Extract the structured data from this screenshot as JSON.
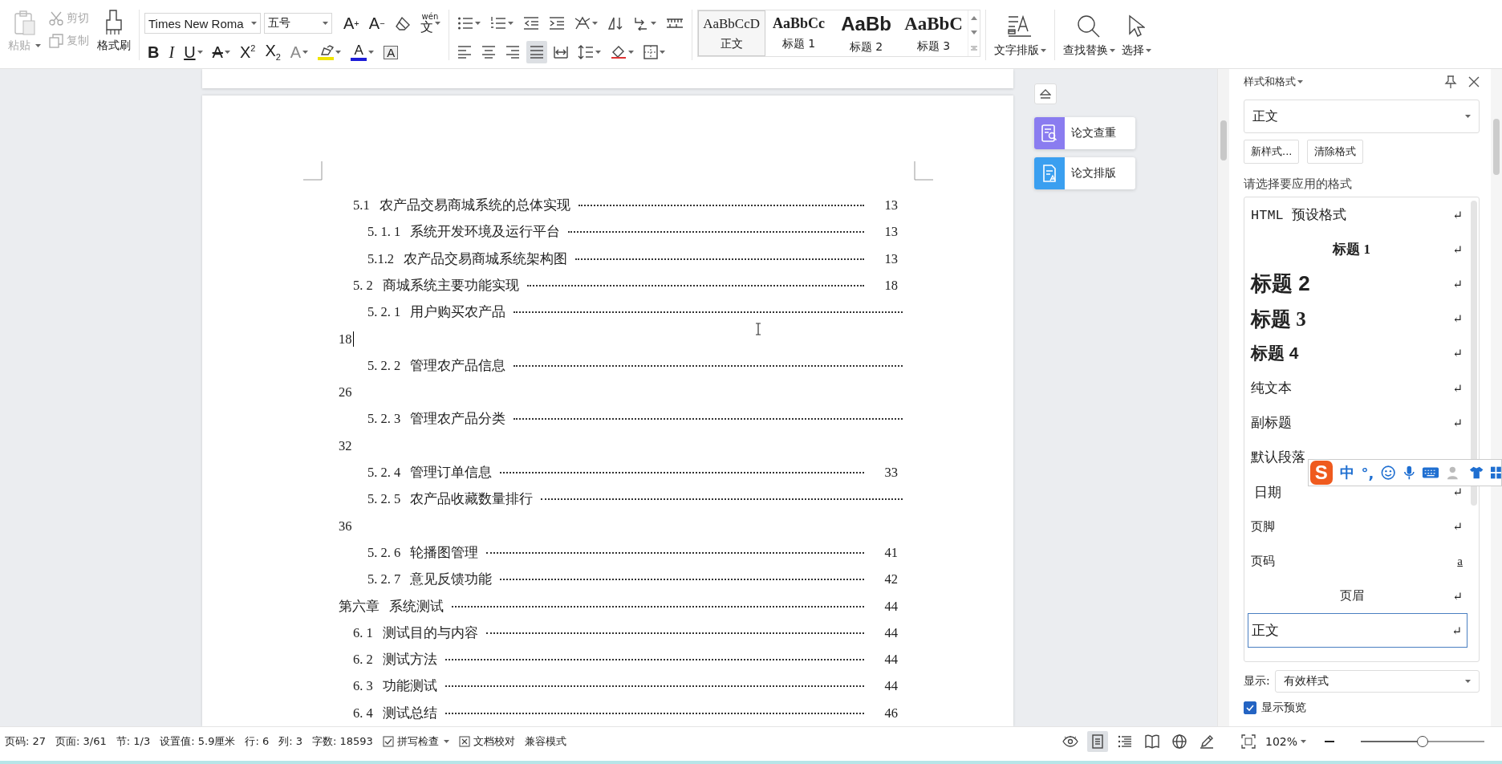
{
  "toolbar": {
    "clipboard": [
      {
        "kind": "paste",
        "label": "粘贴",
        "disabled": true,
        "caret": true
      },
      {
        "kind": "cut",
        "label": "剪切",
        "disabled": true,
        "caret": false
      },
      {
        "kind": "copy",
        "label": "复制",
        "disabled": true,
        "caret": false
      },
      {
        "kind": "painter",
        "label": "格式刷",
        "disabled": false,
        "caret": false
      }
    ],
    "font_name": "Times New Roma",
    "font_size": "五号",
    "font_tools": [
      {
        "kind": "grow",
        "glyph": "A$^{+}$"
      },
      {
        "kind": "shrink",
        "glyph": "A$^{−}$"
      },
      {
        "kind": "clear"
      },
      {
        "kind": "pinyin",
        "glyph": "wén",
        "base": "文"
      }
    ],
    "format_tools": [
      {
        "kind": "bold",
        "glyph": "B",
        "caret": false,
        "disabled": false
      },
      {
        "kind": "italic",
        "glyph": "I",
        "caret": false,
        "disabled": false
      },
      {
        "kind": "underline",
        "glyph": "U",
        "caret": true,
        "disabled": false
      },
      {
        "kind": "strike",
        "glyph": "A",
        "caret": true,
        "disabled": false
      },
      {
        "kind": "sup",
        "glyph": "X$^{2}$",
        "caret": false,
        "disabled": false
      },
      {
        "kind": "sub",
        "glyph": "X$_{2}$",
        "caret": false,
        "disabled": false
      },
      {
        "kind": "effect",
        "glyph": "A",
        "caret": true,
        "disabled": true
      },
      {
        "kind": "highlight",
        "caret": true,
        "disabled": false,
        "color": "#f0e400"
      },
      {
        "kind": "color",
        "glyph": "A",
        "caret": true,
        "disabled": false,
        "color": "#1c1cd8"
      },
      {
        "kind": "boxed",
        "glyph": "A",
        "caret": false,
        "disabled": false
      }
    ],
    "paragraph_row1": [
      {
        "kind": "bullets",
        "caret": true
      },
      {
        "kind": "numbering",
        "caret": true
      },
      {
        "kind": "outdent",
        "caret": false
      },
      {
        "kind": "indent",
        "caret": false
      },
      {
        "kind": "cnlayout",
        "caret": true
      },
      {
        "kind": "sort",
        "caret": false
      },
      {
        "kind": "direction",
        "caret": true
      },
      {
        "kind": "tabs",
        "caret": false
      }
    ],
    "alignment": [
      {
        "kind": "left",
        "selected": false
      },
      {
        "kind": "center",
        "selected": false
      },
      {
        "kind": "right",
        "selected": false
      },
      {
        "kind": "justify",
        "selected": true
      },
      {
        "kind": "distribute",
        "selected": false
      }
    ],
    "paragraph_row2": [
      {
        "kind": "linespacing",
        "caret": true
      },
      {
        "kind": "shading",
        "caret": true
      },
      {
        "kind": "borders",
        "caret": true
      }
    ],
    "styles": [
      {
        "kind": "normal",
        "preview": "AaBbCcD",
        "label": "正文",
        "selected": true
      },
      {
        "kind": "h1",
        "preview": "AaBbCc",
        "label": "标题 1",
        "selected": false
      },
      {
        "kind": "h2",
        "preview": "AaBb",
        "label": "标题 2",
        "selected": false
      },
      {
        "kind": "h3",
        "preview": "AaBbC",
        "label": "标题 3",
        "selected": false
      }
    ],
    "tools": [
      {
        "kind": "textlayout",
        "label": "文字排版"
      },
      {
        "kind": "find",
        "label": "查找替换"
      },
      {
        "kind": "select",
        "label": "选择"
      }
    ]
  },
  "side_tools": [
    {
      "kind": "check",
      "label": "论文查重"
    },
    {
      "kind": "layout",
      "label": "论文排版"
    }
  ],
  "toc": [
    {
      "kind": "section",
      "num": "5.1",
      "title": "农产品交易商城系统的总体实现",
      "page": "13",
      "wrap": false,
      "cursor": false,
      "children": [
        {
          "kind": "subsection",
          "num": "5. 1. 1",
          "title": "系统开发环境及运行平台",
          "page": "13",
          "wrap": false,
          "cursor": false
        },
        {
          "kind": "subsection",
          "num": "5.1.2",
          "title": "农产品交易商城系统架构图",
          "page": "13",
          "wrap": false,
          "cursor": false
        }
      ]
    },
    {
      "kind": "section",
      "num": "5. 2",
      "title": "商城系统主要功能实现",
      "page": "18",
      "wrap": false,
      "cursor": false,
      "children": [
        {
          "kind": "subsection",
          "num": "5. 2. 1",
          "title": "用户购买农产品",
          "page": "18",
          "wrap": true,
          "cursor": true
        },
        {
          "kind": "subsection",
          "num": "5. 2. 2",
          "title": "管理农产品信息",
          "page": "26",
          "wrap": true,
          "cursor": false
        },
        {
          "kind": "subsection",
          "num": "5. 2. 3",
          "title": "管理农产品分类",
          "page": "32",
          "wrap": true,
          "cursor": false
        },
        {
          "kind": "subsection",
          "num": "5. 2. 4",
          "title": "管理订单信息",
          "page": "33",
          "wrap": false,
          "cursor": false
        },
        {
          "kind": "subsection",
          "num": "5. 2. 5",
          "title": "农产品收藏数量排行",
          "page": "36",
          "wrap": true,
          "cursor": false
        },
        {
          "kind": "subsection",
          "num": "5. 2. 6",
          "title": "轮播图管理",
          "page": "41",
          "wrap": false,
          "cursor": false
        },
        {
          "kind": "subsection",
          "num": "5. 2. 7",
          "title": "意见反馈功能",
          "page": "42",
          "wrap": false,
          "cursor": false
        }
      ]
    },
    {
      "kind": "chapter",
      "num": "第六章",
      "title": "系统测试",
      "page": "44",
      "wrap": false,
      "cursor": false,
      "children": [
        {
          "kind": "section",
          "num": "6. 1",
          "title": "测试目的与内容",
          "page": "44",
          "wrap": false,
          "cursor": false
        },
        {
          "kind": "section",
          "num": "6. 2",
          "title": "测试方法",
          "page": "44",
          "wrap": false,
          "cursor": false
        },
        {
          "kind": "section",
          "num": "6. 3",
          "title": "功能测试",
          "page": "44",
          "wrap": false,
          "cursor": false
        },
        {
          "kind": "section",
          "num": "6. 4",
          "title": "测试总结",
          "page": "46",
          "wrap": false,
          "cursor": false
        }
      ]
    }
  ],
  "panel": {
    "title": "样式和格式",
    "current_style": "正文",
    "buttons": [
      "新样式...",
      "清除格式"
    ],
    "prompt": "请选择要应用的格式",
    "styles": [
      {
        "kind": "html",
        "text": "HTML 预设格式",
        "mark": "↵",
        "selected": false
      },
      {
        "kind": "h1",
        "text": "标题 1",
        "mark": "↵",
        "selected": false
      },
      {
        "kind": "h2",
        "text": "标题 2",
        "mark": "↵",
        "selected": false
      },
      {
        "kind": "h3",
        "text": "标题 3",
        "mark": "↵",
        "selected": false
      },
      {
        "kind": "h4",
        "text": "标题 4",
        "mark": "↵",
        "selected": false
      },
      {
        "kind": "plain",
        "text": "纯文本",
        "mark": "↵",
        "selected": false
      },
      {
        "kind": "plain",
        "text": "副标题",
        "mark": "↵",
        "selected": false
      },
      {
        "kind": "plain",
        "text": "默认段落",
        "selected": false
      },
      {
        "kind": "date",
        "text": "日期",
        "mark": "↵",
        "selected": false
      },
      {
        "kind": "sans",
        "text": "页脚",
        "mark": "↵",
        "selected": false
      },
      {
        "kind": "char",
        "text": "页码",
        "mark": "a",
        "selected": false
      },
      {
        "kind": "header",
        "text": "页眉",
        "mark": "↵",
        "selected": false
      },
      {
        "kind": "plain",
        "text": "正文",
        "mark": "↵",
        "selected": true
      }
    ],
    "show_label": "显示:",
    "show_value": "有效样式",
    "preview_label": "显示预览",
    "preview_checked": true
  },
  "ime": {
    "logo": "S",
    "mode": "中",
    "punct": "°,"
  },
  "status_bar": {
    "items": [
      "页码: 27",
      "页面: 3/61",
      "节: 1/3",
      "设置值: 5.9厘米",
      "行: 6",
      "列: 3",
      "字数: 18593"
    ],
    "spell_check": "拼写检查",
    "proofread": "文档校对",
    "compat": "兼容模式",
    "views": [
      {
        "kind": "page",
        "selected": true
      },
      {
        "kind": "outline",
        "selected": false
      },
      {
        "kind": "reading",
        "selected": false
      },
      {
        "kind": "web",
        "selected": false
      },
      {
        "kind": "pen",
        "selected": false
      }
    ],
    "zoom": "102%",
    "zoom_level": {
      "level": 0.5
    }
  }
}
